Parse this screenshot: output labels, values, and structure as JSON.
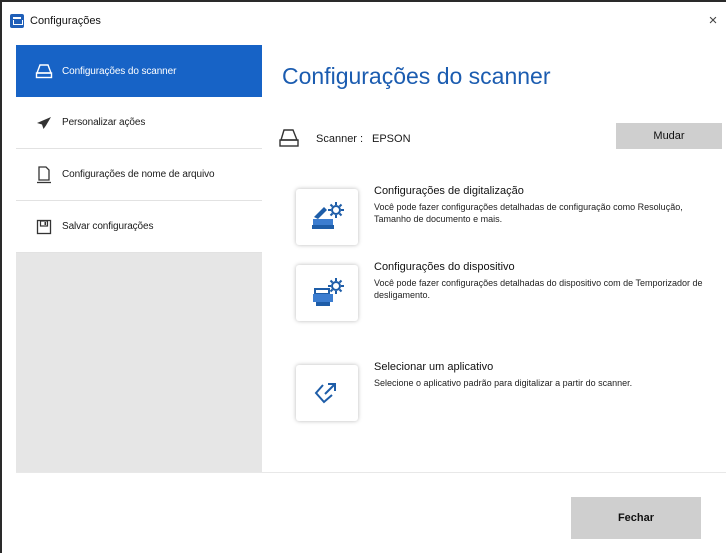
{
  "window": {
    "title": "Configurações",
    "close_glyph": "×",
    "accent_color": "#1763c6"
  },
  "sidebar": {
    "items": [
      {
        "label": "Configurações do scanner",
        "icon": "scanner-icon",
        "active": true
      },
      {
        "label": "Personalizar ações",
        "icon": "paper-plane-icon",
        "active": false
      },
      {
        "label": "Configurações de nome de arquivo",
        "icon": "document-icon",
        "active": false
      },
      {
        "label": "Salvar configurações",
        "icon": "save-icon",
        "active": false
      }
    ]
  },
  "main": {
    "title": "Configurações do scanner",
    "scanner": {
      "label": "Scanner :",
      "value": "EPSON",
      "change_button": "Mudar"
    },
    "options": [
      {
        "icon": "scan-settings-icon",
        "title": "Configurações de digitalização",
        "description": "Você pode fazer configurações detalhadas de configuração como Resolução, Tamanho de documento e mais."
      },
      {
        "icon": "device-settings-icon",
        "title": "Configurações do dispositivo",
        "description": "Você pode fazer configurações detalhadas do dispositivo com de Temporizador de desligamento."
      },
      {
        "icon": "select-app-icon",
        "title": "Selecionar um aplicativo",
        "description": "Selecione o aplicativo padrão para digitalizar a partir do scanner."
      }
    ]
  },
  "footer": {
    "close_button": "Fechar"
  }
}
